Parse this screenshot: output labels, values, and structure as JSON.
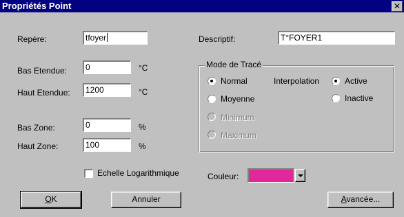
{
  "window": {
    "title": "Propriétés Point",
    "close_glyph": "✕"
  },
  "fields": {
    "repere": {
      "label": "Repère:",
      "value": "tfoyer"
    },
    "descriptif": {
      "label": "Descriptif:",
      "value": "T°FOYER1"
    },
    "bas_etendue": {
      "label": "Bas Etendue:",
      "value": "0",
      "unit": "°C"
    },
    "haut_etendue": {
      "label": "Haut Etendue:",
      "value": "1200",
      "unit": "°C"
    },
    "bas_zone": {
      "label": "Bas Zone:",
      "value": "0",
      "unit": "%"
    },
    "haut_zone": {
      "label": "Haut Zone:",
      "value": "100",
      "unit": "%"
    }
  },
  "mode_trace": {
    "legend": "Mode de Tracé",
    "options": [
      {
        "label": "Normal",
        "selected": true,
        "enabled": true
      },
      {
        "label": "Moyenne",
        "selected": false,
        "enabled": true
      },
      {
        "label": "Minimum",
        "selected": false,
        "enabled": false
      },
      {
        "label": "Maximum",
        "selected": false,
        "enabled": false
      }
    ],
    "interpolation": {
      "label": "Interpolation",
      "options": [
        {
          "label": "Active",
          "selected": true
        },
        {
          "label": "Inactive",
          "selected": false
        }
      ]
    }
  },
  "echelle": {
    "label": "Echelle Logarithmique",
    "checked": false
  },
  "couleur": {
    "label": "Couleur:",
    "value": "#e0289b"
  },
  "buttons": {
    "ok_accel": "O",
    "ok_rest": "K",
    "annuler": "Annuler",
    "avancee_accel": "A",
    "avancee_rest": "vancée..."
  }
}
